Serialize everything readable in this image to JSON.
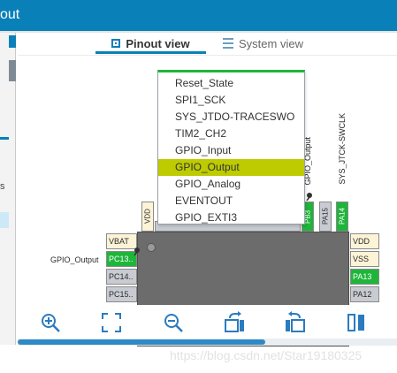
{
  "window": {
    "title_fragment": "out"
  },
  "left_panel": {
    "letter": "s"
  },
  "tabs": [
    {
      "label": "Pinout view",
      "active": true
    },
    {
      "label": "System view",
      "active": false
    }
  ],
  "dropdown": {
    "items": [
      "Reset_State",
      "SPI1_SCK",
      "SYS_JTDO-TRACESWO",
      "TIM2_CH2",
      "GPIO_Input",
      "GPIO_Output",
      "GPIO_Analog",
      "EVENTOUT",
      "GPIO_EXTI3"
    ],
    "selected": "GPIO_Output"
  },
  "chip": {
    "top_pins": [
      {
        "label": "VDD",
        "state": "power"
      },
      {
        "label": "PB3",
        "state": "assigned"
      },
      {
        "label": "PA15",
        "state": "unassigned"
      },
      {
        "label": "PA14",
        "state": "assigned"
      }
    ],
    "top_signal_labels": {
      "pb3": "GPIO_Output",
      "pa14": "SYS_JTCK-SWCLK"
    },
    "left_pins": [
      {
        "label": "VBAT",
        "state": "power"
      },
      {
        "label": "PC13..",
        "state": "assigned"
      },
      {
        "label": "PC14..",
        "state": "unassigned"
      },
      {
        "label": "PC15..",
        "state": "unassigned"
      }
    ],
    "left_signal_label": "GPIO_Output",
    "right_pins": [
      {
        "label": "VDD",
        "state": "power"
      },
      {
        "label": "VSS",
        "state": "power"
      },
      {
        "label": "PA13",
        "state": "assigned"
      },
      {
        "label": "PA12",
        "state": "unassigned"
      }
    ]
  },
  "toolbar": {
    "icons": [
      "zoom-in-icon",
      "fit-screen-icon",
      "zoom-out-icon",
      "rotate-right-icon",
      "rotate-left-icon",
      "split-view-icon"
    ]
  },
  "watermark": "https://blog.csdn.net/Star19180325",
  "colors": {
    "header": "#0a80b8",
    "assigned_pin": "#1eb53a",
    "power_pin": "#fdf3d6",
    "selected_item": "#bdcb00",
    "chip_body": "#6c6c6c"
  }
}
